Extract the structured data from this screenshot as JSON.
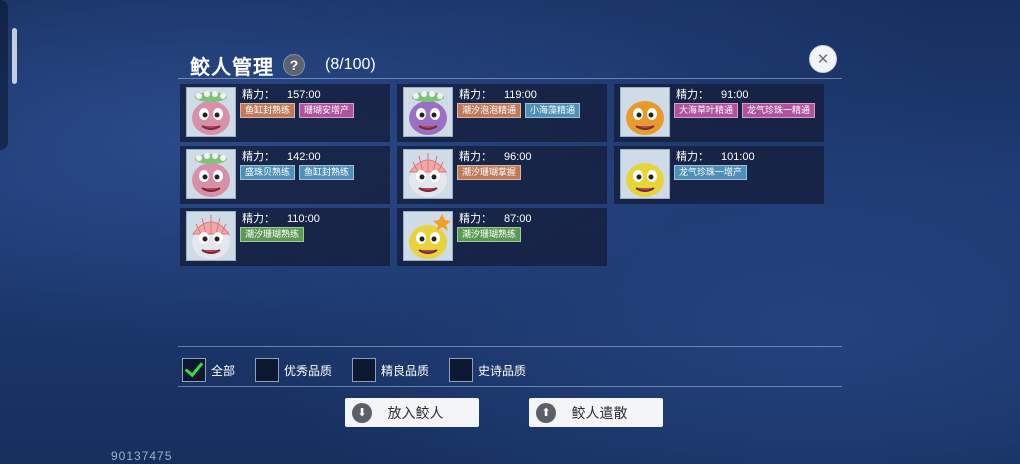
{
  "title": "鲛人管理",
  "help_icon": "question-icon",
  "count": "(8/100)",
  "stamina_label": "精力：",
  "merfolk": [
    {
      "stamina": "157:00",
      "face": "pink",
      "color": "#d88fa8",
      "crown": "flower",
      "tags": [
        {
          "text": "鱼缸封熟练",
          "color": "#c07a5a"
        },
        {
          "text": "珊瑚安增产",
          "color": "#b0529e"
        }
      ]
    },
    {
      "stamina": "119:00",
      "face": "purple",
      "color": "#9b6fc4",
      "crown": "flower",
      "tags": [
        {
          "text": "潮汐泡泡精通",
          "color": "#c07a5a"
        },
        {
          "text": "小海藻精通",
          "color": "#4f8fb8"
        }
      ]
    },
    {
      "stamina": "91:00",
      "face": "orange",
      "color": "#e89a2a",
      "crown": "none",
      "tags": [
        {
          "text": "大海草叶精通",
          "color": "#b0529e"
        },
        {
          "text": "龙气珍珠一精通",
          "color": "#b0529e"
        }
      ]
    },
    {
      "stamina": "142:00",
      "face": "pink",
      "color": "#d88fa8",
      "crown": "flower",
      "tags": [
        {
          "text": "盛珠贝熟练",
          "color": "#4f8fb8"
        },
        {
          "text": "鱼缸封熟练",
          "color": "#4f8fb8"
        }
      ]
    },
    {
      "stamina": "96:00",
      "face": "white",
      "color": "#e4e8ee",
      "crown": "shell",
      "tags": [
        {
          "text": "潮汐珊瑚掌握",
          "color": "#c07a5a"
        }
      ]
    },
    {
      "stamina": "101:00",
      "face": "yellow",
      "color": "#e8d43a",
      "crown": "none",
      "tags": [
        {
          "text": "龙气珍珠一增产",
          "color": "#4f8fb8"
        }
      ]
    },
    {
      "stamina": "110:00",
      "face": "white",
      "color": "#e4e8ee",
      "crown": "shell",
      "tags": [
        {
          "text": "潮汐珊瑚熟练",
          "color": "#5a9a52"
        }
      ]
    },
    {
      "stamina": "87:00",
      "face": "yellow",
      "color": "#e8d43a",
      "crown": "star",
      "tags": [
        {
          "text": "潮汐珊瑚熟练",
          "color": "#5a9a52"
        }
      ]
    }
  ],
  "filters": [
    {
      "label": "全部",
      "checked": true
    },
    {
      "label": "优秀品质",
      "checked": false
    },
    {
      "label": "精良品质",
      "checked": false
    },
    {
      "label": "史诗品质",
      "checked": false
    }
  ],
  "buttons": {
    "put_in": "放入鲛人",
    "dismiss": "鲛人遣散"
  },
  "uid": "90137475"
}
